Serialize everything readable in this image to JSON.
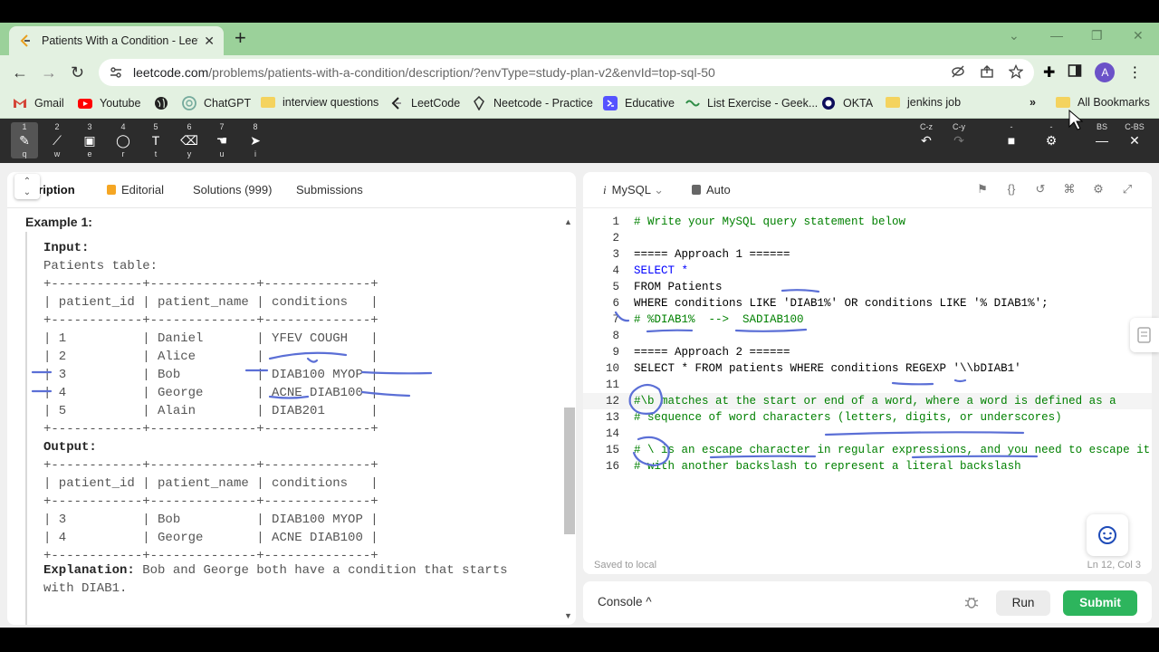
{
  "browser": {
    "tab_title": "Patients With a Condition - Leet",
    "url_host": "leetcode.com",
    "url_path": "/problems/patients-with-a-condition/description/?envType=study-plan-v2&envId=top-sql-50",
    "avatar_letter": "A",
    "bookmarks": [
      {
        "label": "Gmail",
        "icon": "gmail-icon"
      },
      {
        "label": "Youtube",
        "icon": "youtube-icon"
      },
      {
        "label": "",
        "icon": "globe-icon"
      },
      {
        "label": "ChatGPT",
        "icon": "chatgpt-icon"
      },
      {
        "label": "interview questions",
        "icon": "folder-icon"
      },
      {
        "label": "LeetCode",
        "icon": "leetcode-icon"
      },
      {
        "label": "Neetcode - Practice",
        "icon": "neetcode-icon"
      },
      {
        "label": "Educative",
        "icon": "educative-icon"
      },
      {
        "label": "List Exercise - Geek...",
        "icon": "gfg-icon"
      },
      {
        "label": "OKTA",
        "icon": "okta-icon"
      },
      {
        "label": "jenkins job",
        "icon": "folder-icon"
      }
    ],
    "more_bookmarks": "»",
    "all_bookmarks": "All Bookmarks"
  },
  "annotation_toolbar": {
    "tools": [
      {
        "num": "1",
        "key": "q",
        "glyph": "✎",
        "name": "pen-tool"
      },
      {
        "num": "2",
        "key": "w",
        "glyph": "⟋",
        "name": "line-tool"
      },
      {
        "num": "3",
        "key": "e",
        "glyph": "▣",
        "name": "rect-tool"
      },
      {
        "num": "4",
        "key": "r",
        "glyph": "◯",
        "name": "ellipse-tool"
      },
      {
        "num": "5",
        "key": "t",
        "glyph": "T",
        "name": "text-tool"
      },
      {
        "num": "6",
        "key": "y",
        "glyph": "⌫",
        "name": "eraser-tool"
      },
      {
        "num": "7",
        "key": "u",
        "glyph": "☚",
        "name": "hand-tool"
      },
      {
        "num": "8",
        "key": "i",
        "glyph": "➤",
        "name": "pointer-tool"
      }
    ],
    "right_tools": [
      {
        "num": "C-z",
        "glyph": "↶",
        "name": "undo-tool"
      },
      {
        "num": "C-y",
        "glyph": "↷",
        "name": "redo-tool"
      },
      {
        "num": "-",
        "glyph": "■",
        "name": "clear-tool"
      },
      {
        "num": "-",
        "glyph": "⚙",
        "name": "settings-tool"
      },
      {
        "num": "BS",
        "glyph": "—",
        "name": "minimize-tool"
      },
      {
        "num": "C-BS",
        "glyph": "✕",
        "name": "close-tool"
      }
    ]
  },
  "left_panel": {
    "tabs": {
      "description": "cription",
      "editorial": "Editorial",
      "solutions": "Solutions (999)",
      "submissions": "Submissions"
    },
    "example_title": "Example 1:",
    "input_label": "Input:",
    "table_label": "Patients table:",
    "input_table": "+------------+--------------+--------------+\n| patient_id | patient_name | conditions   |\n+------------+--------------+--------------+\n| 1          | Daniel       | YFEV COUGH   |\n| 2          | Alice        |              |\n| 3          | Bob          | DIAB100 MYOP |\n| 4          | George       | ACNE DIAB100 |\n| 5          | Alain        | DIAB201      |\n+------------+--------------+--------------+",
    "output_label": "Output:",
    "output_table": "+------------+--------------+--------------+\n| patient_id | patient_name | conditions   |\n+------------+--------------+--------------+\n| 3          | Bob          | DIAB100 MYOP |\n| 4          | George       | ACNE DIAB100 |\n+------------+--------------+--------------+",
    "explanation_label": "Explanation:",
    "explanation_text": " Bob and George both have a condition that starts with DIAB1."
  },
  "editor": {
    "language": "MySQL",
    "mode": "Auto",
    "status_left": "Saved to local",
    "status_right": "Ln 12, Col 3",
    "lines": [
      {
        "n": "1",
        "text": "# Write your MySQL query statement below"
      },
      {
        "n": "2",
        "text": ""
      },
      {
        "n": "3",
        "text": "===== Approach 1 ======"
      },
      {
        "n": "4",
        "text": "SELECT *"
      },
      {
        "n": "5",
        "text": "FROM Patients"
      },
      {
        "n": "6",
        "text": "WHERE conditions LIKE 'DIAB1%' OR conditions LIKE '% DIAB1%';"
      },
      {
        "n": "7",
        "text": "# %DIAB1%  -->  SADIAB100"
      },
      {
        "n": "8",
        "text": ""
      },
      {
        "n": "9",
        "text": "===== Approach 2 ======"
      },
      {
        "n": "10",
        "text": "SELECT * FROM patients WHERE conditions REGEXP '\\\\bDIAB1'"
      },
      {
        "n": "11",
        "text": ""
      },
      {
        "n": "12",
        "text": "#\\b matches at the start or end of a word, where a word is defined as a"
      },
      {
        "n": "13",
        "text": "# sequence of word characters (letters, digits, or underscores)"
      },
      {
        "n": "14",
        "text": ""
      },
      {
        "n": "15",
        "text": "# \\ is an escape character in regular expressions, and you need to escape it"
      },
      {
        "n": "16",
        "text": "# with another backslash to represent a literal backslash"
      }
    ]
  },
  "console": {
    "label": "Console ^",
    "run": "Run",
    "submit": "Submit"
  },
  "colors": {
    "accent_green": "#2db55d",
    "tab_strip": "#9bd19a",
    "ink": "#5b6fd6"
  }
}
